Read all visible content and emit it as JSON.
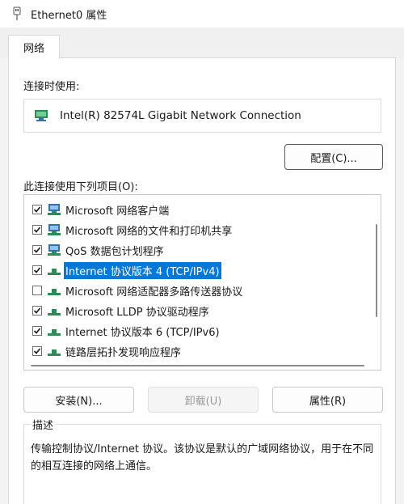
{
  "window": {
    "title": "Ethernet0 属性"
  },
  "tabs": [
    {
      "label": "网络",
      "active": true
    }
  ],
  "connect_using": {
    "label": "连接时使用:",
    "adapter_name": "Intel(R) 82574L Gigabit Network Connection",
    "configure_button": "配置(C)..."
  },
  "items_section": {
    "label": "此连接使用下列项目(O):",
    "items": [
      {
        "label": "Microsoft 网络客户端",
        "checked": true,
        "icon": "network-client-icon",
        "selected": false
      },
      {
        "label": "Microsoft 网络的文件和打印机共享",
        "checked": true,
        "icon": "network-service-icon",
        "selected": false
      },
      {
        "label": "QoS 数据包计划程序",
        "checked": true,
        "icon": "network-service-icon",
        "selected": false
      },
      {
        "label": "Internet 协议版本 4 (TCP/IPv4)",
        "checked": true,
        "icon": "protocol-icon",
        "selected": true
      },
      {
        "label": "Microsoft 网络适配器多路传送器协议",
        "checked": false,
        "icon": "protocol-icon",
        "selected": false
      },
      {
        "label": "Microsoft LLDP 协议驱动程序",
        "checked": true,
        "icon": "protocol-icon",
        "selected": false
      },
      {
        "label": "Internet 协议版本 6 (TCP/IPv6)",
        "checked": true,
        "icon": "protocol-icon",
        "selected": false
      },
      {
        "label": "链路层拓扑发现响应程序",
        "checked": true,
        "icon": "protocol-icon",
        "selected": false
      }
    ]
  },
  "actions": {
    "install": "安装(N)...",
    "uninstall": "卸载(U)",
    "properties": "属性(R)"
  },
  "description": {
    "legend": "描述",
    "text": "传输控制协议/Internet 协议。该协议是默认的广域网络协议，用于在不同的相互连接的网络上通信。"
  },
  "colors": {
    "selection": "#0078d7",
    "border": "#c8c8c8"
  }
}
